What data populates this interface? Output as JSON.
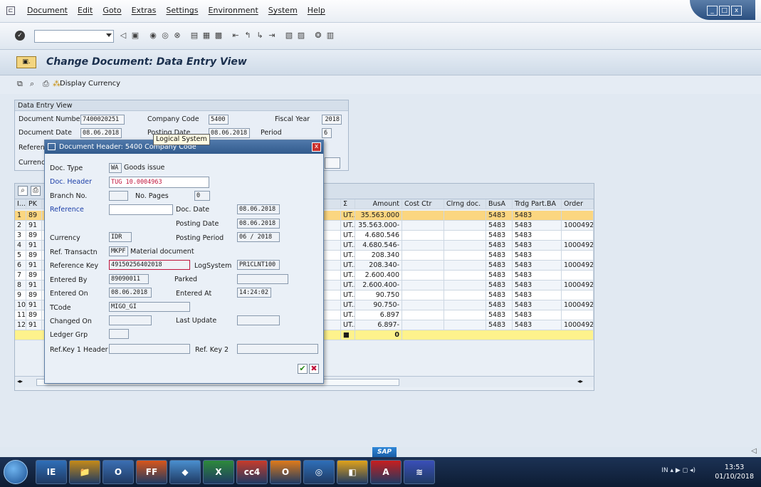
{
  "menu": {
    "items": [
      "Document",
      "Edit",
      "Goto",
      "Extras",
      "Settings",
      "Environment",
      "System",
      "Help"
    ]
  },
  "window_controls": {
    "minimize": "_",
    "maximize": "□",
    "close": "x"
  },
  "toolbar": {
    "command_value": ""
  },
  "title": {
    "text": "Change Document: Data Entry View"
  },
  "app_toolbar": {
    "display_currency_label": "Display Currency"
  },
  "data_entry_view": {
    "group_title": "Data Entry View",
    "doc_number_label": "Document Number",
    "doc_number": "7400020251",
    "company_code_label": "Company Code",
    "company_code": "5400",
    "fiscal_year_label": "Fiscal Year",
    "fiscal_year": "2018",
    "doc_date_label": "Document Date",
    "doc_date": "08.06.2018",
    "posting_date_label": "Posting Date",
    "posting_date": "08.06.2018",
    "period_label": "Period",
    "period": "6",
    "reference_label": "Referenc",
    "currency_label": "Currency"
  },
  "table": {
    "headers": [
      "I...",
      "PK",
      "Σ",
      "Amount",
      "Cost Ctr",
      "Clrng doc.",
      "BusA",
      "Trdg Part.BA",
      "Order"
    ],
    "rows": [
      {
        "i": "1",
        "pk": "89",
        "t": "UT...",
        "amount": "35.563.000",
        "busa": "5483",
        "tpba": "5483",
        "order": ""
      },
      {
        "i": "2",
        "pk": "91",
        "t": "UT...",
        "amount": "35.563.000-",
        "busa": "5483",
        "tpba": "5483",
        "order": "10004928"
      },
      {
        "i": "3",
        "pk": "89",
        "t": "UT...",
        "amount": "4.680.546",
        "busa": "5483",
        "tpba": "5483",
        "order": ""
      },
      {
        "i": "4",
        "pk": "91",
        "t": "UT...",
        "amount": "4.680.546-",
        "busa": "5483",
        "tpba": "5483",
        "order": "10004928"
      },
      {
        "i": "5",
        "pk": "89",
        "t": "UT...",
        "amount": "208.340",
        "busa": "5483",
        "tpba": "5483",
        "order": ""
      },
      {
        "i": "6",
        "pk": "91",
        "t": "UT...",
        "amount": "208.340-",
        "busa": "5483",
        "tpba": "5483",
        "order": "10004928"
      },
      {
        "i": "7",
        "pk": "89",
        "t": "UT...",
        "amount": "2.600.400",
        "busa": "5483",
        "tpba": "5483",
        "order": ""
      },
      {
        "i": "8",
        "pk": "91",
        "t": "UT...",
        "amount": "2.600.400-",
        "busa": "5483",
        "tpba": "5483",
        "order": "10004928"
      },
      {
        "i": "9",
        "pk": "89",
        "t": "UT...",
        "amount": "90.750",
        "busa": "5483",
        "tpba": "5483",
        "order": ""
      },
      {
        "i": "10",
        "pk": "91",
        "t": "UT...",
        "amount": "90.750-",
        "busa": "5483",
        "tpba": "5483",
        "order": "10004928"
      },
      {
        "i": "11",
        "pk": "89",
        "t": "UT...",
        "amount": "6.897",
        "busa": "5483",
        "tpba": "5483",
        "order": ""
      },
      {
        "i": "12",
        "pk": "91",
        "t": "UT...",
        "amount": "6.897-",
        "busa": "5483",
        "tpba": "5483",
        "order": "10004928"
      }
    ],
    "total_marker": "■",
    "total_amount": "0"
  },
  "popup": {
    "title": "Document Header: 5400 Company Code",
    "doc_type_label": "Doc. Type",
    "doc_type": "WA",
    "doc_type_text": "Goods issue",
    "doc_header_label": "Doc. Header",
    "doc_header": "TUG 10.0004963",
    "branch_label": "Branch No.",
    "branch": "",
    "no_pages_label": "No. Pages",
    "no_pages": "0",
    "reference_label": "Reference",
    "reference": "",
    "doc_date_label": "Doc. Date",
    "doc_date": "08.06.2018",
    "posting_date_label": "Posting Date",
    "posting_date": "08.06.2018",
    "currency_label": "Currency",
    "currency": "IDR",
    "posting_period_label": "Posting Period",
    "posting_period": "06",
    "posting_year": "2018",
    "period_sep": "/",
    "ref_trans_label": "Ref. Transactn",
    "ref_trans": "MKPF",
    "ref_trans_text": "Material document",
    "ref_key_label": "Reference Key",
    "ref_key": "49150256402018",
    "log_system_label": "LogSystem",
    "log_system": "PR1CLNT100",
    "entered_by_label": "Entered By",
    "entered_by": "89090011",
    "parked_label": "Parked",
    "entered_on_label": "Entered On",
    "entered_on": "08.06.2018",
    "entered_at_label": "Entered At",
    "entered_at": "14:24:02",
    "tcode_label": "TCode",
    "tcode": "MIGO_GI",
    "changed_on_label": "Changed On",
    "changed_on": "",
    "last_update_label": "Last Update",
    "last_update": "",
    "ledger_grp_label": "Ledger Grp",
    "ledger_grp": "",
    "ref_key1_label": "Ref.Key 1 Header",
    "ref_key1": "",
    "ref_key2_label": "Ref. Key 2",
    "ref_key2": "",
    "tooltip": "Logical System"
  },
  "status": {
    "sap_logo": "SAP",
    "right_symbol": "◁"
  },
  "taskbar": {
    "apps": [
      "IE",
      "📁",
      "O",
      "FF",
      "◆",
      "X",
      "cc4",
      "O",
      "◎",
      "◧",
      "A",
      "≋"
    ],
    "tray": "IN  ▴  ▶  ◻  ◂)",
    "time": "13:53",
    "date": "01/10/2018"
  },
  "colors": {
    "selected_row": "#fbd680",
    "total_row": "#fef28c",
    "popup_title": "#325b8d",
    "doc_header_text": "#c0143c"
  }
}
